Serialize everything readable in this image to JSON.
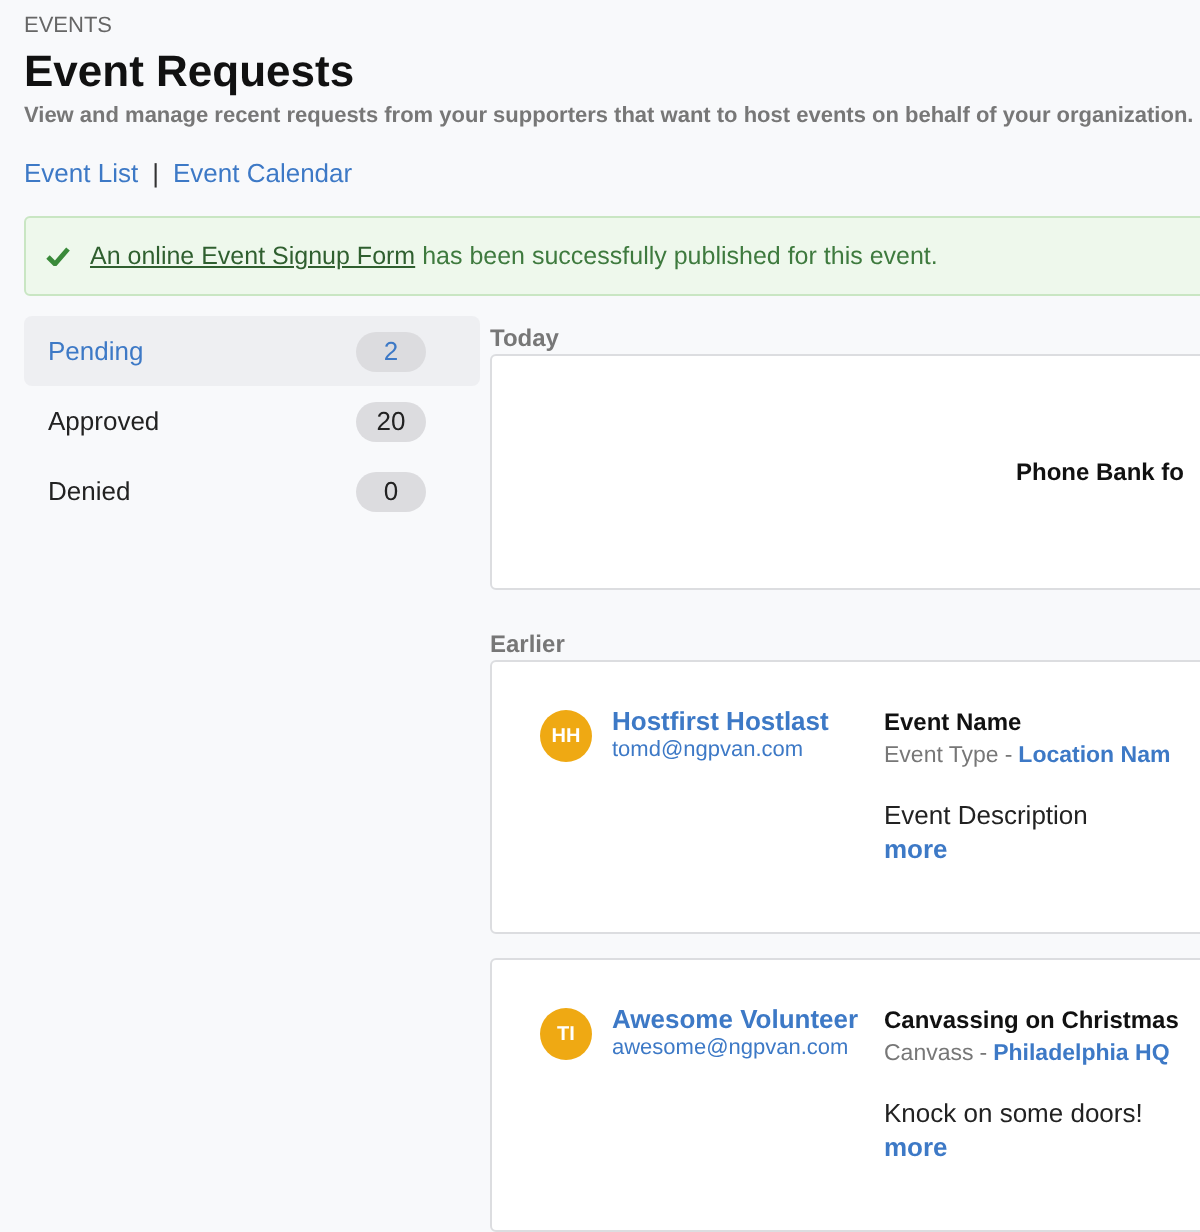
{
  "breadcrumb": "EVENTS",
  "title": "Event Requests",
  "subtitle": "View and manage recent requests from your supporters that want to host events on behalf of your organization.",
  "nav_links": [
    {
      "label": "Event List"
    },
    {
      "label": "Event Calendar"
    }
  ],
  "nav_separator": "|",
  "banner": {
    "link": "An online Event Signup Form",
    "text": "has been successfully published for this event."
  },
  "sidebar": {
    "items": [
      {
        "label": "Pending",
        "count": "2",
        "selected": true
      },
      {
        "label": "Approved",
        "count": "20",
        "selected": false
      },
      {
        "label": "Denied",
        "count": "0",
        "selected": false
      }
    ]
  },
  "sections": [
    {
      "heading": "Today",
      "cards": [
        {
          "kind": "summary",
          "title": "Phone Bank fo"
        }
      ]
    },
    {
      "heading": "Earlier",
      "cards": [
        {
          "kind": "request",
          "initials": "HH",
          "name": "Hostfirst Hostlast",
          "email": "tomd@ngpvan.com",
          "event_name": "Event Name",
          "event_type": "Event Type",
          "separator": "-",
          "location": "Location Nam",
          "description": "Event Description",
          "more": "more"
        },
        {
          "kind": "request",
          "initials": "TI",
          "name": "Awesome Volunteer",
          "email": "awesome@ngpvan.com",
          "event_name": "Canvassing on Christmas",
          "event_type": "Canvass",
          "separator": "-",
          "location": "Philadelphia HQ",
          "description": "Knock on some doors!",
          "more": "more"
        }
      ]
    }
  ]
}
